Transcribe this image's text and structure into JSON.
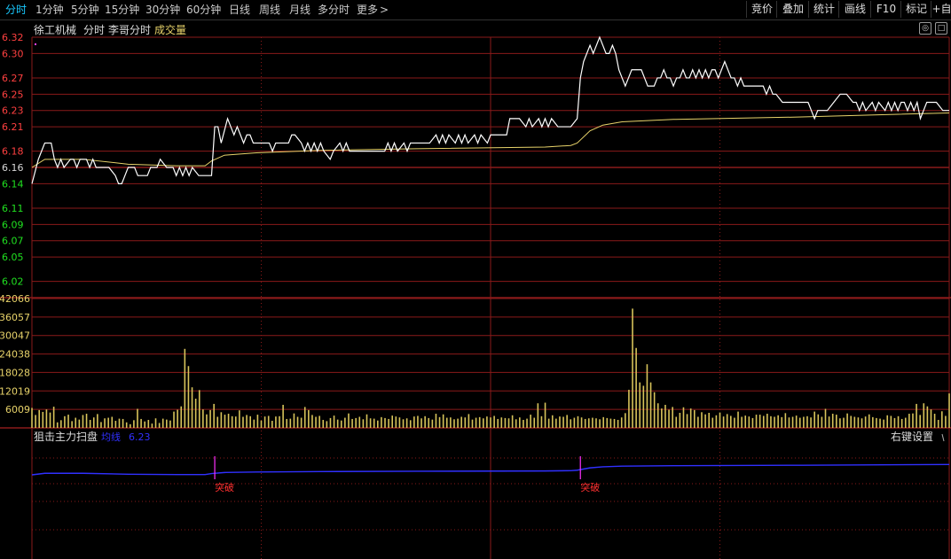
{
  "toolbar": {
    "tabs": [
      {
        "label": "分时",
        "active": true
      },
      {
        "label": "1分钟"
      },
      {
        "label": "5分钟"
      },
      {
        "label": "15分钟"
      },
      {
        "label": "30分钟"
      },
      {
        "label": "60分钟"
      },
      {
        "label": "日线"
      },
      {
        "label": "周线"
      },
      {
        "label": "月线"
      },
      {
        "label": "多分时"
      },
      {
        "label": "更多"
      }
    ],
    "more_chevron": "chevron-right-icon",
    "right": [
      {
        "label": "竞价"
      },
      {
        "label": "叠加"
      },
      {
        "label": "统计"
      },
      {
        "label": "画线"
      },
      {
        "label": "F10"
      },
      {
        "label": "标记"
      },
      {
        "label": "+自"
      }
    ]
  },
  "header": {
    "stock_name": "徐工机械",
    "mode": "分时",
    "indicator": "李哥分时",
    "volume_label": "成交量"
  },
  "indicator_panel": {
    "name": "狙击主力扫盘",
    "line_label": "均线",
    "line_value": "6.23",
    "settings_label": "右键设置",
    "signal_label": "突破"
  },
  "colors": {
    "background": "#000000",
    "grid": "#8a1a1a",
    "price_line": "#ffffff",
    "avg_line": "#e8d36a",
    "up": "#ff4040",
    "down": "#20e020",
    "flat": "#d8d8d8",
    "volume_bar": "#d7c35a",
    "signal_line": "#3030ff",
    "signal_mark": "#ff30ff",
    "signal_text": "#ff3030",
    "active_tab": "#19c9ff",
    "volume_axis": "#e8d36a"
  },
  "chart_data": {
    "type": "line",
    "x_range": [
      0,
      240
    ],
    "price_axis": {
      "ylim": [
        6.0,
        6.32
      ],
      "reference": 6.16,
      "tick_labels": [
        "6.32",
        "6.30",
        "6.27",
        "6.25",
        "6.23",
        "6.21",
        "6.18",
        "6.16",
        "6.14",
        "6.11",
        "6.09",
        "6.07",
        "6.05",
        "6.02"
      ],
      "tick_values": [
        6.32,
        6.3,
        6.27,
        6.25,
        6.23,
        6.21,
        6.18,
        6.16,
        6.14,
        6.11,
        6.09,
        6.07,
        6.05,
        6.02
      ]
    },
    "price_series": {
      "points": [
        [
          0,
          6.14
        ],
        [
          2,
          6.17
        ],
        [
          3,
          6.18
        ],
        [
          4,
          6.19
        ],
        [
          6,
          6.19
        ],
        [
          7,
          6.17
        ],
        [
          8,
          6.16
        ],
        [
          9,
          6.17
        ],
        [
          10,
          6.16
        ],
        [
          12,
          6.17
        ],
        [
          13,
          6.17
        ],
        [
          14,
          6.16
        ],
        [
          15,
          6.17
        ],
        [
          17,
          6.17
        ],
        [
          18,
          6.16
        ],
        [
          19,
          6.17
        ],
        [
          20,
          6.16
        ],
        [
          22,
          6.16
        ],
        [
          24,
          6.16
        ],
        [
          26,
          6.15
        ],
        [
          27,
          6.14
        ],
        [
          28,
          6.14
        ],
        [
          29,
          6.15
        ],
        [
          30,
          6.16
        ],
        [
          32,
          6.16
        ],
        [
          33,
          6.15
        ],
        [
          34,
          6.15
        ],
        [
          36,
          6.15
        ],
        [
          37,
          6.16
        ],
        [
          38,
          6.16
        ],
        [
          39,
          6.16
        ],
        [
          40,
          6.17
        ],
        [
          42,
          6.16
        ],
        [
          44,
          6.16
        ],
        [
          45,
          6.15
        ],
        [
          46,
          6.16
        ],
        [
          47,
          6.15
        ],
        [
          48,
          6.16
        ],
        [
          49,
          6.15
        ],
        [
          50,
          6.16
        ],
        [
          52,
          6.15
        ],
        [
          54,
          6.15
        ],
        [
          55,
          6.15
        ],
        [
          56,
          6.15
        ],
        [
          57,
          6.21
        ],
        [
          58,
          6.21
        ],
        [
          59,
          6.19
        ],
        [
          61,
          6.22
        ],
        [
          62,
          6.21
        ],
        [
          63,
          6.2
        ],
        [
          64,
          6.21
        ],
        [
          65,
          6.2
        ],
        [
          66,
          6.19
        ],
        [
          67,
          6.2
        ],
        [
          68,
          6.2
        ],
        [
          69,
          6.19
        ],
        [
          71,
          6.19
        ],
        [
          72,
          6.19
        ],
        [
          74,
          6.19
        ],
        [
          75,
          6.18
        ],
        [
          76,
          6.19
        ],
        [
          78,
          6.19
        ],
        [
          80,
          6.19
        ],
        [
          81,
          6.2
        ],
        [
          82,
          6.2
        ],
        [
          84,
          6.19
        ],
        [
          85,
          6.18
        ],
        [
          86,
          6.19
        ],
        [
          87,
          6.18
        ],
        [
          88,
          6.19
        ],
        [
          89,
          6.18
        ],
        [
          90,
          6.19
        ],
        [
          91,
          6.18
        ],
        [
          93,
          6.17
        ],
        [
          94,
          6.18
        ],
        [
          96,
          6.19
        ],
        [
          97,
          6.18
        ],
        [
          98,
          6.19
        ],
        [
          99,
          6.18
        ],
        [
          100,
          6.18
        ],
        [
          102,
          6.18
        ],
        [
          104,
          6.18
        ],
        [
          105,
          6.18
        ],
        [
          106,
          6.18
        ],
        [
          108,
          6.18
        ],
        [
          110,
          6.18
        ],
        [
          111,
          6.19
        ],
        [
          112,
          6.18
        ],
        [
          113,
          6.19
        ],
        [
          114,
          6.18
        ],
        [
          116,
          6.19
        ],
        [
          117,
          6.18
        ],
        [
          118,
          6.19
        ],
        [
          120,
          6.19
        ],
        [
          122,
          6.19
        ],
        [
          124,
          6.19
        ],
        [
          126,
          6.2
        ],
        [
          127,
          6.19
        ],
        [
          128,
          6.2
        ],
        [
          129,
          6.19
        ],
        [
          130,
          6.2
        ],
        [
          132,
          6.19
        ],
        [
          133,
          6.2
        ],
        [
          134,
          6.19
        ],
        [
          135,
          6.2
        ],
        [
          136,
          6.19
        ],
        [
          138,
          6.2
        ],
        [
          139,
          6.19
        ],
        [
          140,
          6.2
        ],
        [
          142,
          6.19
        ],
        [
          143,
          6.2
        ],
        [
          144,
          6.2
        ],
        [
          146,
          6.2
        ],
        [
          148,
          6.2
        ],
        [
          149,
          6.22
        ],
        [
          150,
          6.22
        ],
        [
          152,
          6.22
        ],
        [
          154,
          6.21
        ],
        [
          155,
          6.22
        ],
        [
          156,
          6.21
        ],
        [
          158,
          6.22
        ],
        [
          159,
          6.21
        ],
        [
          160,
          6.22
        ],
        [
          161,
          6.21
        ],
        [
          162,
          6.22
        ],
        [
          164,
          6.21
        ],
        [
          166,
          6.21
        ],
        [
          168,
          6.21
        ],
        [
          170,
          6.22
        ],
        [
          171,
          6.27
        ],
        [
          172,
          6.29
        ],
        [
          173,
          6.3
        ],
        [
          174,
          6.31
        ],
        [
          175,
          6.3
        ],
        [
          176,
          6.31
        ],
        [
          177,
          6.32
        ],
        [
          178,
          6.31
        ],
        [
          179,
          6.3
        ],
        [
          180,
          6.3
        ],
        [
          181,
          6.31
        ],
        [
          182,
          6.3
        ],
        [
          183,
          6.28
        ],
        [
          184,
          6.27
        ],
        [
          185,
          6.26
        ],
        [
          186,
          6.27
        ],
        [
          187,
          6.28
        ],
        [
          188,
          6.28
        ],
        [
          189,
          6.28
        ],
        [
          190,
          6.28
        ],
        [
          191,
          6.27
        ],
        [
          192,
          6.26
        ],
        [
          193,
          6.26
        ],
        [
          194,
          6.26
        ],
        [
          195,
          6.27
        ],
        [
          196,
          6.27
        ],
        [
          197,
          6.28
        ],
        [
          198,
          6.27
        ],
        [
          199,
          6.27
        ],
        [
          200,
          6.26
        ],
        [
          201,
          6.27
        ],
        [
          202,
          6.27
        ],
        [
          203,
          6.28
        ],
        [
          204,
          6.27
        ],
        [
          205,
          6.27
        ],
        [
          206,
          6.28
        ],
        [
          207,
          6.27
        ],
        [
          208,
          6.28
        ],
        [
          209,
          6.27
        ],
        [
          210,
          6.28
        ],
        [
          211,
          6.27
        ],
        [
          212,
          6.28
        ],
        [
          213,
          6.28
        ],
        [
          214,
          6.27
        ],
        [
          215,
          6.28
        ],
        [
          216,
          6.29
        ],
        [
          217,
          6.28
        ],
        [
          218,
          6.27
        ],
        [
          219,
          6.27
        ],
        [
          220,
          6.26
        ],
        [
          221,
          6.27
        ],
        [
          222,
          6.26
        ],
        [
          224,
          6.26
        ],
        [
          226,
          6.26
        ],
        [
          228,
          6.26
        ],
        [
          229,
          6.25
        ],
        [
          230,
          6.26
        ],
        [
          231,
          6.25
        ],
        [
          232,
          6.25
        ],
        [
          234,
          6.24
        ],
        [
          236,
          6.24
        ],
        [
          238,
          6.24
        ],
        [
          240,
          6.24
        ],
        [
          242,
          6.24
        ],
        [
          243,
          6.23
        ],
        [
          244,
          6.22
        ],
        [
          245,
          6.23
        ],
        [
          246,
          6.23
        ],
        [
          248,
          6.23
        ],
        [
          250,
          6.24
        ],
        [
          252,
          6.25
        ],
        [
          254,
          6.25
        ],
        [
          256,
          6.24
        ],
        [
          257,
          6.24
        ],
        [
          258,
          6.23
        ],
        [
          259,
          6.24
        ],
        [
          260,
          6.23
        ],
        [
          262,
          6.24
        ],
        [
          263,
          6.23
        ],
        [
          264,
          6.24
        ],
        [
          266,
          6.23
        ],
        [
          267,
          6.24
        ],
        [
          268,
          6.23
        ],
        [
          269,
          6.24
        ],
        [
          270,
          6.23
        ],
        [
          271,
          6.24
        ],
        [
          272,
          6.24
        ],
        [
          273,
          6.23
        ],
        [
          274,
          6.24
        ],
        [
          275,
          6.23
        ],
        [
          276,
          6.24
        ],
        [
          277,
          6.22
        ],
        [
          278,
          6.23
        ],
        [
          279,
          6.24
        ],
        [
          280,
          6.24
        ],
        [
          282,
          6.24
        ],
        [
          284,
          6.23
        ],
        [
          286,
          6.23
        ]
      ]
    },
    "avg_series": {
      "points": [
        [
          0,
          6.16
        ],
        [
          4,
          6.17
        ],
        [
          8,
          6.17
        ],
        [
          16,
          6.17
        ],
        [
          30,
          6.164
        ],
        [
          45,
          6.162
        ],
        [
          54,
          6.162
        ],
        [
          56,
          6.168
        ],
        [
          60,
          6.175
        ],
        [
          70,
          6.178
        ],
        [
          90,
          6.181
        ],
        [
          120,
          6.183
        ],
        [
          160,
          6.185
        ],
        [
          168,
          6.187
        ],
        [
          170,
          6.19
        ],
        [
          174,
          6.205
        ],
        [
          178,
          6.212
        ],
        [
          184,
          6.216
        ],
        [
          200,
          6.219
        ],
        [
          240,
          6.222
        ],
        [
          286,
          6.227
        ]
      ]
    },
    "volume_axis": {
      "ylim": [
        0,
        42066
      ],
      "tick_labels": [
        "42066",
        "36057",
        "30047",
        "24038",
        "18028",
        "12019",
        "6009"
      ],
      "tick_values": [
        42066,
        36057,
        30047,
        24038,
        18028,
        12019,
        6009
      ]
    },
    "volume_bars": {
      "values": [
        6500,
        4200,
        5800,
        5200,
        6000,
        5000,
        6900,
        1800,
        2500,
        3800,
        4300,
        2200,
        3300,
        2700,
        4200,
        4600,
        2600,
        3400,
        4500,
        1900,
        3100,
        3300,
        3600,
        2300,
        3000,
        2900,
        1800,
        1200,
        2500,
        6200,
        2900,
        2100,
        2600,
        1400,
        3100,
        1600,
        3000,
        2700,
        2400,
        5300,
        5900,
        7000,
        25700,
        20100,
        13200,
        9500,
        12300,
        6000,
        4400,
        5800,
        7800,
        3600,
        5100,
        4300,
        4600,
        3800,
        3700,
        5700,
        3600,
        4200,
        3800,
        2700,
        4300,
        2400,
        3700,
        3900,
        2300,
        3700,
        3800,
        7500,
        2900,
        3000,
        4700,
        3600,
        3300,
        6800,
        5800,
        4200,
        3600,
        3900,
        2600,
        2200,
        3200,
        4000,
        2700,
        2400,
        3300,
        4700,
        2900,
        3200,
        3600,
        2800,
        4400,
        3100,
        3000,
        2400,
        3500,
        3200,
        2900,
        4000,
        3700,
        3400,
        2800,
        3100,
        2500,
        3700,
        3900,
        3100,
        3800,
        3200,
        2700,
        4600,
        3500,
        4400,
        3300,
        3400,
        2800,
        3000,
        3600,
        3400,
        4500,
        2700,
        3300,
        3500,
        3100,
        3700,
        3400,
        3900,
        2900,
        3400,
        3200,
        3100,
        4100,
        2800,
        3400,
        2600,
        3000,
        4300,
        3300,
        8000,
        3800,
        8200,
        3000,
        4100,
        3000,
        3700,
        3600,
        4200,
        2800,
        3300,
        3800,
        3400,
        2900,
        3100,
        3300,
        3100,
        2800,
        3500,
        3200,
        3000,
        2900,
        2600,
        3400,
        4800,
        12400,
        38800,
        26000,
        14800,
        13700,
        20700,
        14800,
        11600,
        8000,
        6300,
        7500,
        5900,
        6800,
        3600,
        4900,
        6700,
        4500,
        6300,
        5800,
        3600,
        5100,
        4400,
        4900,
        3300,
        4100,
        5000,
        3700,
        4500,
        3900,
        3300,
        5300,
        3600,
        4000,
        3700,
        3200,
        4300,
        4300,
        3900,
        4600,
        3800,
        3600,
        4100,
        3500,
        4800,
        3400,
        3600,
        4000,
        3300,
        3600,
        3800,
        3400,
        5300,
        4400,
        3600,
        6200,
        3700,
        4600,
        4300,
        3100,
        3300,
        4700,
        3900,
        3600,
        3400,
        3100,
        3700,
        4400,
        3500,
        3200,
        3000,
        2700,
        4100,
        3900,
        3200,
        3800,
        2900,
        3300,
        4600,
        4700,
        7800,
        4200,
        8000,
        7000,
        6000,
        4600,
        2600,
        5400,
        3900,
        11200
      ]
    },
    "indicator": {
      "line_value": 6.23,
      "signals": [
        57,
        171
      ]
    }
  }
}
